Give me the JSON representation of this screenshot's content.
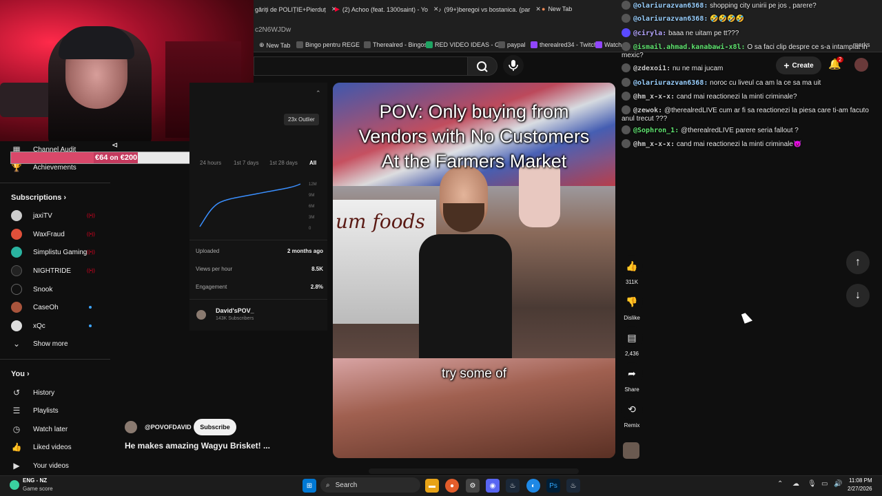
{
  "browser": {
    "tabs": [
      {
        "label": "găriți de POLIȚIE+Pierduț",
        "icon": "tab-icon"
      },
      {
        "label": "(2) Achoo (feat. 1300saint) - Yo",
        "icon": "youtube-icon"
      },
      {
        "label": "(99+)beregoi vs bostanica. (par",
        "icon": "tiktok-icon"
      },
      {
        "label": "New Tab",
        "icon": "chrome-icon"
      }
    ],
    "url": "c2N6WJDw",
    "bookmarks": [
      "New Tab",
      "Bingo pentru REGE",
      "Therealred - Bingos",
      "RED VIDEO IDEAS - G...",
      "paypal",
      "therealred34 - Twitch",
      "Watch"
    ],
    "bookmarks_more": "marks"
  },
  "overlay": {
    "goal_amount": "€64",
    "goal_on": "on",
    "goal_target": "€200",
    "goal_progress": 0.32
  },
  "sidebar": {
    "top_items": [
      "Channel Audit",
      "Achievements"
    ],
    "subscriptions_title": "Subscriptions",
    "subscriptions": [
      {
        "label": "jaxiTV",
        "marker": "live"
      },
      {
        "label": "WaxFraud",
        "marker": "live"
      },
      {
        "label": "Simplistu Gaming",
        "marker": "live"
      },
      {
        "label": "NIGHTRIDE",
        "marker": "live"
      },
      {
        "label": "Snook",
        "marker": "none"
      },
      {
        "label": "CaseOh",
        "marker": "dot"
      },
      {
        "label": "xQc",
        "marker": "dot"
      }
    ],
    "show_more": "Show more",
    "you_title": "You",
    "you_items": [
      "History",
      "Playlists",
      "Watch later",
      "Liked videos",
      "Your videos"
    ]
  },
  "stats": {
    "outlier": "23x Outlier",
    "ranges": [
      "24 hours",
      "1st 7 days",
      "1st 28 days",
      "All"
    ],
    "active_range": "All",
    "chart_ticks": [
      "12M",
      "9M",
      "6M",
      "3M",
      "0"
    ],
    "uploaded_label": "Uploaded",
    "uploaded_value": "2 months ago",
    "vph_label": "Views per hour",
    "vph_value": "8.5K",
    "engagement_label": "Engagement",
    "engagement_value": "2.8%",
    "channel_name": "David'sPOV_",
    "channel_subs": "143K Subscribers"
  },
  "video": {
    "title_lines": [
      "POV: Only buying from",
      "Vendors with No Customers",
      "At the Farmers Market"
    ],
    "caption": "try some of",
    "truck_sign": "um foods"
  },
  "actions": {
    "likes": "311K",
    "dislike": "Dislike",
    "comments": "2,436",
    "share": "Share",
    "remix": "Remix"
  },
  "channel": {
    "handle": "@POVOFDAVID",
    "subscribe": "Subscribe",
    "description": "He makes amazing Wagyu Brisket! ..."
  },
  "header": {
    "create": "Create",
    "notifications": "2"
  },
  "chat": [
    {
      "user": "@olariurazvan6368:",
      "text": "shopping city unirii pe jos , parere?",
      "color": "#9ad0ff"
    },
    {
      "user": "@olariurazvan6368:",
      "text": "🤣🤣🤣🤣",
      "color": "#9ad0ff"
    },
    {
      "user": "@ciryla:",
      "text": "baaa ne uitam pe tt???",
      "color": "#b6a6ff"
    },
    {
      "user": "@ismail.ahmad.kanabawi-x8l:",
      "text": "O sa faci clip despre ce s-a intamplat in mexic?",
      "color": "#5fe36f"
    },
    {
      "user": "@zdexoi1:",
      "text": "nu ne mai jucam",
      "color": "#cccccc"
    },
    {
      "user": "@olariurazvan6368:",
      "text": "noroc cu liveul ca am la ce sa ma uit",
      "color": "#9ad0ff"
    },
    {
      "user": "@hm_x-x-x:",
      "text": "cand mai reactionezi la minti criminale?",
      "color": "#cccccc"
    },
    {
      "user": "@zewok:",
      "text": "@therealredLIVE cum ar fi sa reactionezi la piesa care ti-am facuto anul trecut ???",
      "color": "#cccccc"
    },
    {
      "user": "@Sophron_1:",
      "text": "@therealredLIVE parere seria fallout ?",
      "color": "#5fe36f"
    },
    {
      "user": "@hm_x-x-x:",
      "text": "cand mai reactionezi la minti criminale😈",
      "color": "#cccccc"
    }
  ],
  "taskbar": {
    "weather": "ENG - NZ",
    "game_score": "Game score",
    "search": "Search",
    "time": "11:08 PM",
    "date": "2/27/2026"
  }
}
